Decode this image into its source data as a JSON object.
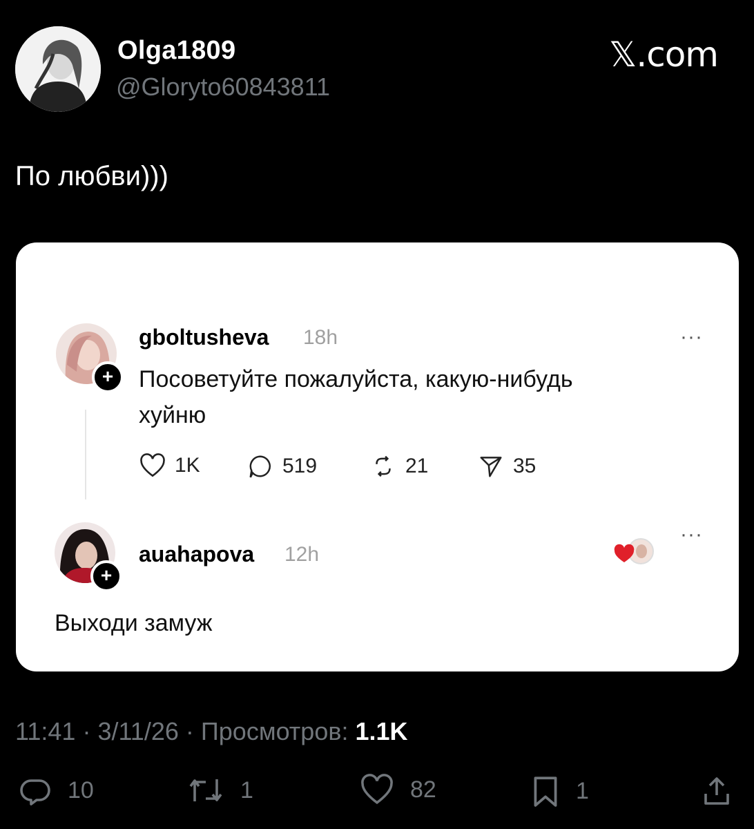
{
  "header": {
    "display_name": "Olga1809",
    "handle": "@Gloryto60843811",
    "brand": "𝕏.com"
  },
  "tweet": {
    "text": "По любви)))"
  },
  "card": {
    "post": {
      "username": "gboltusheva",
      "time": "18h",
      "more": "···",
      "text_line1": "Посоветуйте пожалуйста, какую-нибудь",
      "text_line2": "хуйню",
      "likes": "1K",
      "replies": "519",
      "reposts": "21",
      "shares": "35"
    },
    "reply": {
      "username": "auahapova",
      "time": "12h",
      "more": "···",
      "text": "Выходи замуж"
    }
  },
  "meta": {
    "time": "11:41",
    "date": "3/11/26",
    "views_label": "Просмотров:",
    "views": "1.1K"
  },
  "actions": {
    "replies": "10",
    "reposts": "1",
    "likes": "82",
    "bookmarks": "1"
  },
  "colors": {
    "background": "#000000",
    "muted": "#71767b",
    "card": "#ffffff",
    "heart": "#e0202a"
  },
  "icons": [
    "reply-icon",
    "repost-icon",
    "like-icon",
    "bookmark-icon",
    "share-icon",
    "heart-icon",
    "comment-icon",
    "send-icon",
    "plus-icon"
  ]
}
